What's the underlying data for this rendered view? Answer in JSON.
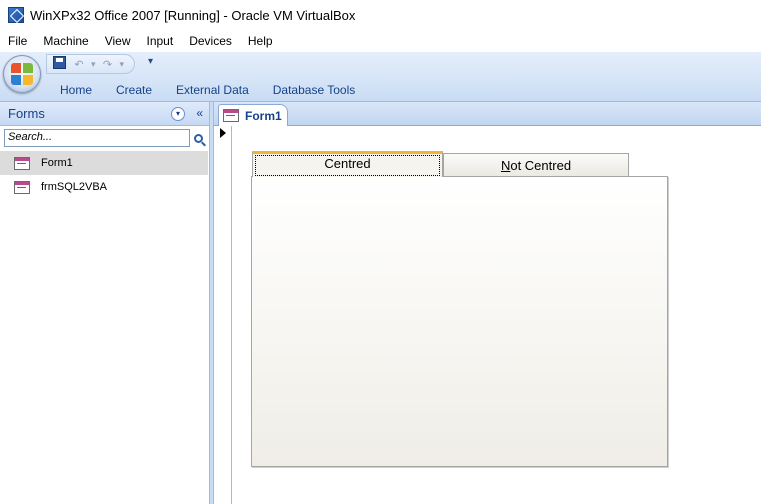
{
  "window": {
    "title": "WinXPx32 Office 2007 [Running] - Oracle VM VirtualBox"
  },
  "vbox_menu": [
    "File",
    "Machine",
    "View",
    "Input",
    "Devices",
    "Help"
  ],
  "quick_access": {
    "undo_symbol": "↶",
    "redo_symbol": "↷",
    "customize_symbol": "▾"
  },
  "ribbon_tabs": [
    "Home",
    "Create",
    "External Data",
    "Database Tools"
  ],
  "nav_pane": {
    "title": "Forms",
    "dropdown_symbol": "▾",
    "collapse_symbol": "«",
    "search_placeholder": "Search...",
    "items": [
      {
        "label": "Form1",
        "selected": true
      },
      {
        "label": "frmSQL2VBA",
        "selected": false
      }
    ]
  },
  "document": {
    "tab_label": "Form1",
    "tab_control": {
      "tab1_label": "Centred",
      "tab2_mnemonic": "N",
      "tab2_rest": "ot Centred"
    }
  },
  "colors": {
    "ribbon_text": "#15428b",
    "active_tab_accent": "#f3b23c",
    "pane_border": "#9ebbe3"
  }
}
